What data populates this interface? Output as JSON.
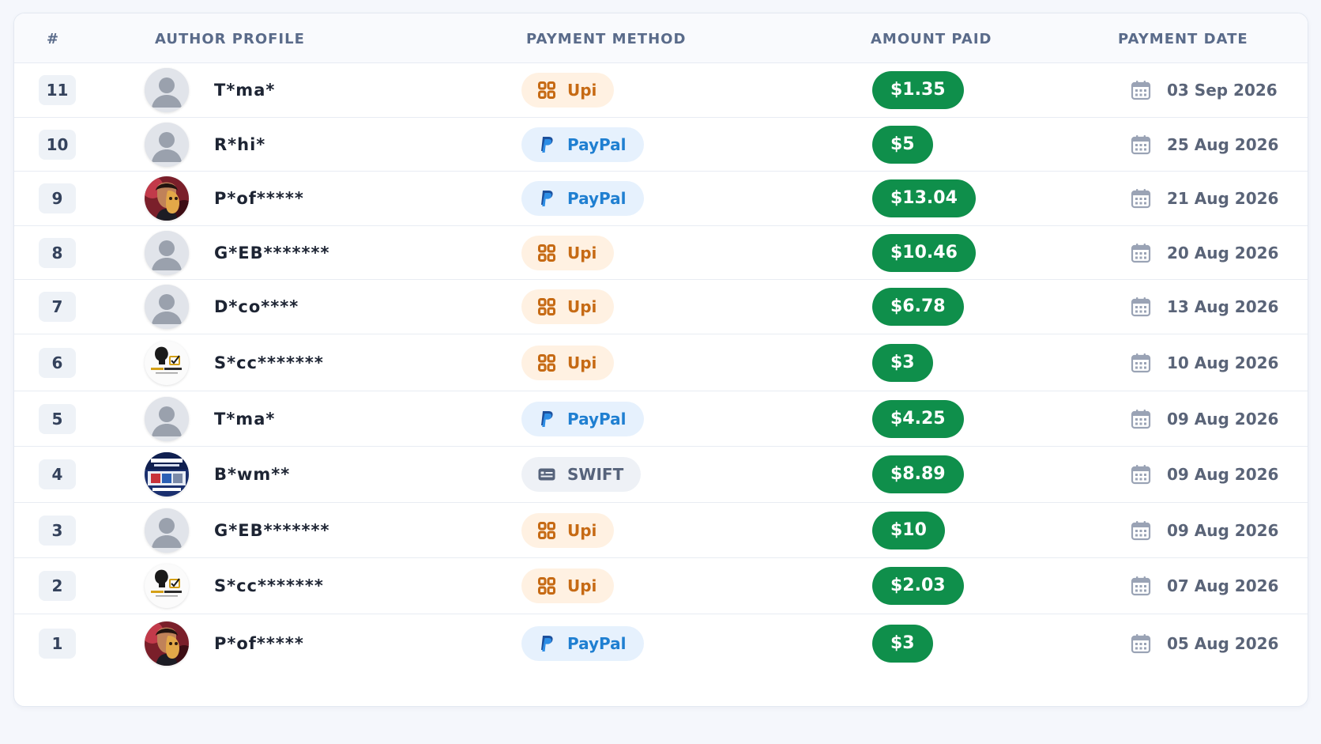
{
  "table": {
    "headers": {
      "num": "#",
      "author": "AUTHOR PROFILE",
      "method": "PAYMENT METHOD",
      "amount": "AMOUNT PAID",
      "date": "PAYMENT DATE"
    },
    "rows": [
      {
        "num": "11",
        "avatar": "default-avatar-icon",
        "author": "T*ma*",
        "method": "Upi",
        "method_icon": "upi-grid-icon",
        "amount": "$1.35",
        "date": "03 Sep 2026"
      },
      {
        "num": "10",
        "avatar": "default-avatar-icon",
        "author": "R*hi*",
        "method": "PayPal",
        "method_icon": "paypal-icon",
        "amount": "$5",
        "date": "25 Aug 2026"
      },
      {
        "num": "9",
        "avatar": "photo-avatar-masked",
        "author": "P*of*****",
        "method": "PayPal",
        "method_icon": "paypal-icon",
        "amount": "$13.04",
        "date": "21 Aug 2026"
      },
      {
        "num": "8",
        "avatar": "default-avatar-icon",
        "author": "G*EB*******",
        "method": "Upi",
        "method_icon": "upi-grid-icon",
        "amount": "$10.46",
        "date": "20 Aug 2026"
      },
      {
        "num": "7",
        "avatar": "default-avatar-icon",
        "author": "D*co****",
        "method": "Upi",
        "method_icon": "upi-grid-icon",
        "amount": "$6.78",
        "date": "13 Aug 2026"
      },
      {
        "num": "6",
        "avatar": "logo-avatar",
        "author": "S*cc*******",
        "method": "Upi",
        "method_icon": "upi-grid-icon",
        "amount": "$3",
        "date": "10 Aug 2026"
      },
      {
        "num": "5",
        "avatar": "default-avatar-icon",
        "author": "T*ma*",
        "method": "PayPal",
        "method_icon": "paypal-icon",
        "amount": "$4.25",
        "date": "09 Aug 2026"
      },
      {
        "num": "4",
        "avatar": "book-cover-avatar",
        "author": "B*wm**",
        "method": "SWIFT",
        "method_icon": "bank-card-icon",
        "amount": "$8.89",
        "date": "09 Aug 2026"
      },
      {
        "num": "3",
        "avatar": "default-avatar-icon",
        "author": "G*EB*******",
        "method": "Upi",
        "method_icon": "upi-grid-icon",
        "amount": "$10",
        "date": "09 Aug 2026"
      },
      {
        "num": "2",
        "avatar": "logo-avatar",
        "author": "S*cc*******",
        "method": "Upi",
        "method_icon": "upi-grid-icon",
        "amount": "$2.03",
        "date": "07 Aug 2026"
      },
      {
        "num": "1",
        "avatar": "photo-avatar-masked",
        "author": "P*of*****",
        "method": "PayPal",
        "method_icon": "paypal-icon",
        "amount": "$3",
        "date": "05 Aug 2026"
      }
    ]
  },
  "colors": {
    "amount_green": "#0f8f4b",
    "upi_orange": "#c66a14",
    "paypal_blue": "#1f7fd1",
    "swift_gray": "#56637b"
  }
}
